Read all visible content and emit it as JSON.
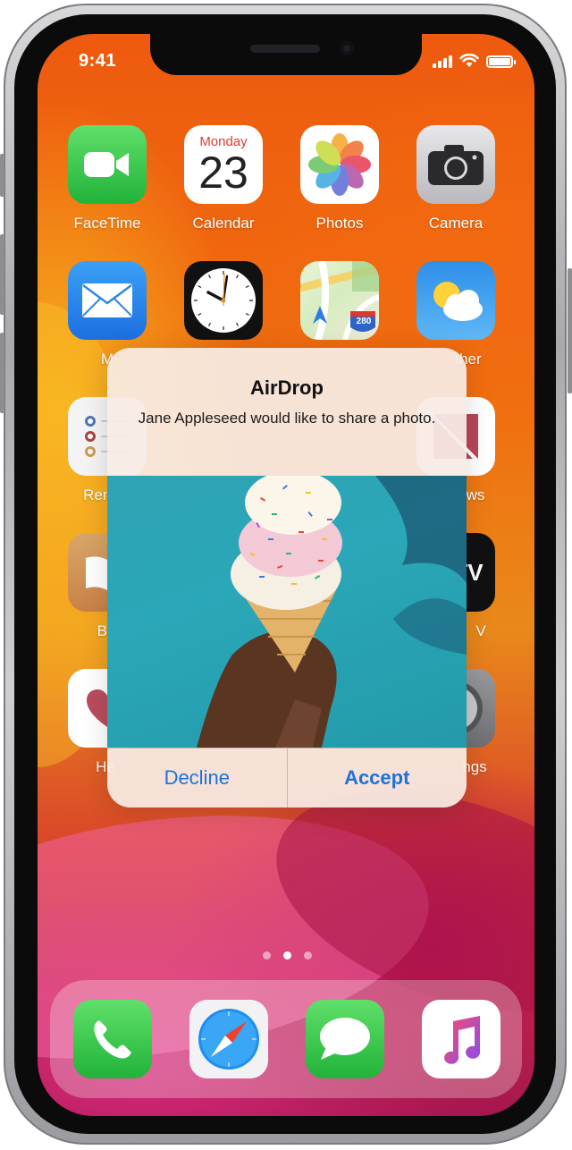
{
  "status_bar": {
    "time": "9:41",
    "signal_icon": "cellular-signal-icon",
    "wifi_icon": "wifi-icon",
    "battery_icon": "battery-icon",
    "battery_level": 1.0
  },
  "home_screen": {
    "row1": [
      {
        "label": "FaceTime",
        "icon": "facetime-icon"
      },
      {
        "label": "Calendar",
        "icon": "calendar-icon",
        "weekday": "Monday",
        "day": "23"
      },
      {
        "label": "Photos",
        "icon": "photos-icon"
      },
      {
        "label": "Camera",
        "icon": "camera-icon"
      }
    ],
    "row2": [
      {
        "label": "M",
        "icon": "mail-icon"
      },
      {
        "label": "",
        "icon": "clock-icon"
      },
      {
        "label": "",
        "icon": "maps-icon",
        "badge": "280"
      },
      {
        "label": "ther",
        "icon": "weather-icon"
      }
    ],
    "row3": [
      {
        "label": "Remi",
        "icon": "reminders-icon"
      },
      {
        "label": "ws",
        "icon": "news-icon"
      }
    ],
    "row4": [
      {
        "label": "Bo",
        "icon": "books-icon"
      },
      {
        "label": "V",
        "icon": "tv-icon",
        "glyph": "tv"
      }
    ],
    "row5": [
      {
        "label": "He",
        "icon": "health-icon"
      },
      {
        "label": "ngs",
        "icon": "settings-icon"
      }
    ],
    "page_dots": {
      "count": 3,
      "active": 1
    },
    "dock": [
      {
        "icon": "phone-icon"
      },
      {
        "icon": "safari-icon"
      },
      {
        "icon": "messages-icon"
      },
      {
        "icon": "music-icon"
      }
    ]
  },
  "alert": {
    "title": "AirDrop",
    "message": "Jane Appleseed would like to share a photo.",
    "photo": "ice-cream-cone-photo",
    "decline_label": "Decline",
    "accept_label": "Accept",
    "button_color": "#1d72d8"
  }
}
